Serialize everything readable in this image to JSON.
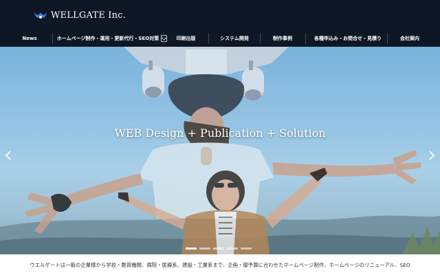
{
  "brand": {
    "name": "WELLGATE Inc.",
    "logo_icon": "wellgate-logo-icon",
    "primary_color": "#0e1726",
    "logo_color": "#3a7bd5"
  },
  "nav": {
    "items": [
      {
        "label": "News"
      },
      {
        "label": "ホームページ制作・運用・更新代行・SEO対策",
        "has_dropdown": true,
        "dropdown_icon": "chevron-down-icon"
      },
      {
        "label": "印刷出版"
      },
      {
        "label": "システム開発"
      },
      {
        "label": "制作事例"
      },
      {
        "label": "各種申込み・お問合せ・見積り"
      },
      {
        "label": "会社案内"
      }
    ]
  },
  "hero": {
    "title": "WEB Design + Publication + Solution",
    "prev_icon": "chevron-left-icon",
    "next_icon": "chevron-right-icon",
    "slides_count": 5,
    "active_slide": 1
  },
  "intro": {
    "text": "ウエルゲートは一般の企業様から学校・教育機関、病院・医療系、建設・工業系まで、企画・御予算に合わせたホームページ制作、ホームページのリニューアル、SEO"
  }
}
